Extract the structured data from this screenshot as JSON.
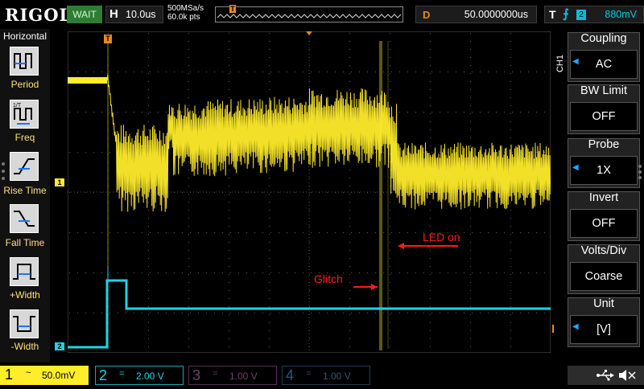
{
  "brand": "RIGOL",
  "run_status": "WAIT",
  "horizontal": {
    "letter": "H",
    "timebase": "10.0us",
    "sample_rate": "500MSa/s",
    "memory": "60.0k pts"
  },
  "delay": {
    "letter": "D",
    "value": "50.0000000us"
  },
  "trigger": {
    "letter": "T",
    "source_number": "2",
    "level": "880mV",
    "marker": "T"
  },
  "left_menu": {
    "title": "Horizontal",
    "items": [
      {
        "label": "Period",
        "icon": "period-measure-icon"
      },
      {
        "label": "Freq",
        "icon": "frequency-measure-icon"
      },
      {
        "label": "Rise Time",
        "icon": "rise-time-icon"
      },
      {
        "label": "Fall Time",
        "icon": "fall-time-icon"
      },
      {
        "label": "+Width",
        "icon": "positive-width-icon"
      },
      {
        "label": "-Width",
        "icon": "negative-width-icon"
      }
    ]
  },
  "right_menu": {
    "channel_tab": "CH1",
    "items": [
      {
        "title": "Coupling",
        "value": "AC",
        "has_arrow": true
      },
      {
        "title": "BW Limit",
        "value": "OFF",
        "has_arrow": false
      },
      {
        "title": "Probe",
        "value": "1X",
        "has_arrow": true
      },
      {
        "title": "Invert",
        "value": "OFF",
        "has_arrow": false
      },
      {
        "title": "Volts/Div",
        "value": "Coarse",
        "has_arrow": false
      },
      {
        "title": "Unit",
        "value": "[V]",
        "has_arrow": true
      }
    ]
  },
  "channels": [
    {
      "number": "1",
      "coupling": "~",
      "scale": "50.0mV",
      "color": "#ffec2a"
    },
    {
      "number": "2",
      "coupling": "=",
      "scale": "2.00 V",
      "color": "#1ad6e6"
    },
    {
      "number": "3",
      "coupling": "=",
      "scale": "1.00 V",
      "color": "#6f3f6f"
    },
    {
      "number": "4",
      "coupling": "=",
      "scale": "1.00 V",
      "color": "#2f5674"
    }
  ],
  "channel_markers": {
    "ch1": "1",
    "ch2": "2"
  },
  "annotations": {
    "glitch": "Glitch",
    "led_on": "LED on"
  },
  "status_icons": [
    "usb-icon",
    "speaker-muted-icon"
  ],
  "colors": {
    "ch1": "#ffec2a",
    "ch2": "#1ad6e6",
    "trigger": "#e58a24",
    "annotation": "#ff1a1a",
    "run": "#2e7d32"
  }
}
